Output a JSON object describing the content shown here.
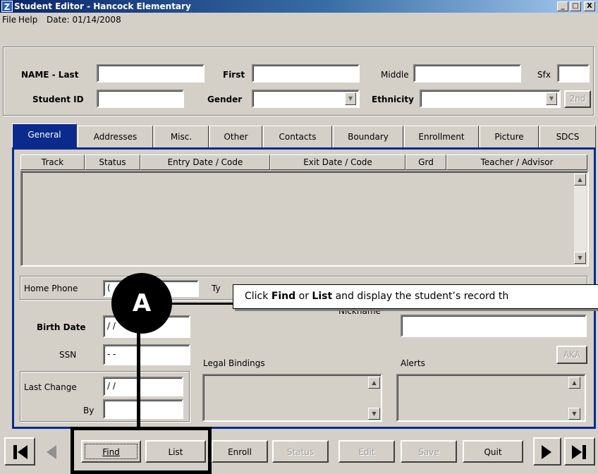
{
  "window": {
    "title": "Student Editor - Hancock Elementary",
    "controls": [
      "_",
      "□",
      "X"
    ]
  },
  "menu": {
    "file": "File",
    "help": "Help",
    "date": "Date: 01/14/2008"
  },
  "header_form": {
    "name_last_label": "NAME - Last",
    "first_label": "First",
    "middle_label": "Middle",
    "sfx_label": "Sfx",
    "student_id_label": "Student ID",
    "gender_label": "Gender",
    "ethnicity_label": "Ethnicity",
    "second_button": "2nd"
  },
  "tabs": [
    "General",
    "Addresses",
    "Misc.",
    "Other",
    "Contacts",
    "Boundary",
    "Enrollment",
    "Picture",
    "SDCS"
  ],
  "active_tab": "General",
  "grid": {
    "columns": [
      "Track",
      "Status",
      "Entry Date / Code",
      "Exit Date / Code",
      "Grd",
      "Teacher / Advisor"
    ]
  },
  "general": {
    "home_phone_label": "Home Phone",
    "home_phone_value": "(",
    "type_label": "Ty",
    "birth_date_label": "Birth Date",
    "birth_date_value": "/ /",
    "nickname_label": "Nickname",
    "ssn_label": "SSN",
    "ssn_value": "- -",
    "legal_bindings_label": "Legal Bindings",
    "alerts_label": "Alerts",
    "aka_button": "AKA",
    "last_change_label": "Last Change",
    "last_change_value": "/ /",
    "by_label": "By"
  },
  "bottom_buttons": {
    "find": "Find",
    "list": "List",
    "enroll": "Enroll",
    "status": "Status",
    "edit": "Edit",
    "save": "Save",
    "quit": "Quit"
  },
  "annotation": {
    "marker": "A",
    "text_prefix": "Click ",
    "find_word": "Find",
    "or_word": " or ",
    "list_word": "List",
    "text_suffix": " and display the student’s record th"
  },
  "colors": {
    "title_bar": "#0a246a",
    "tab_active": "#0a2a8c",
    "window_face": "#d4d0c8"
  }
}
